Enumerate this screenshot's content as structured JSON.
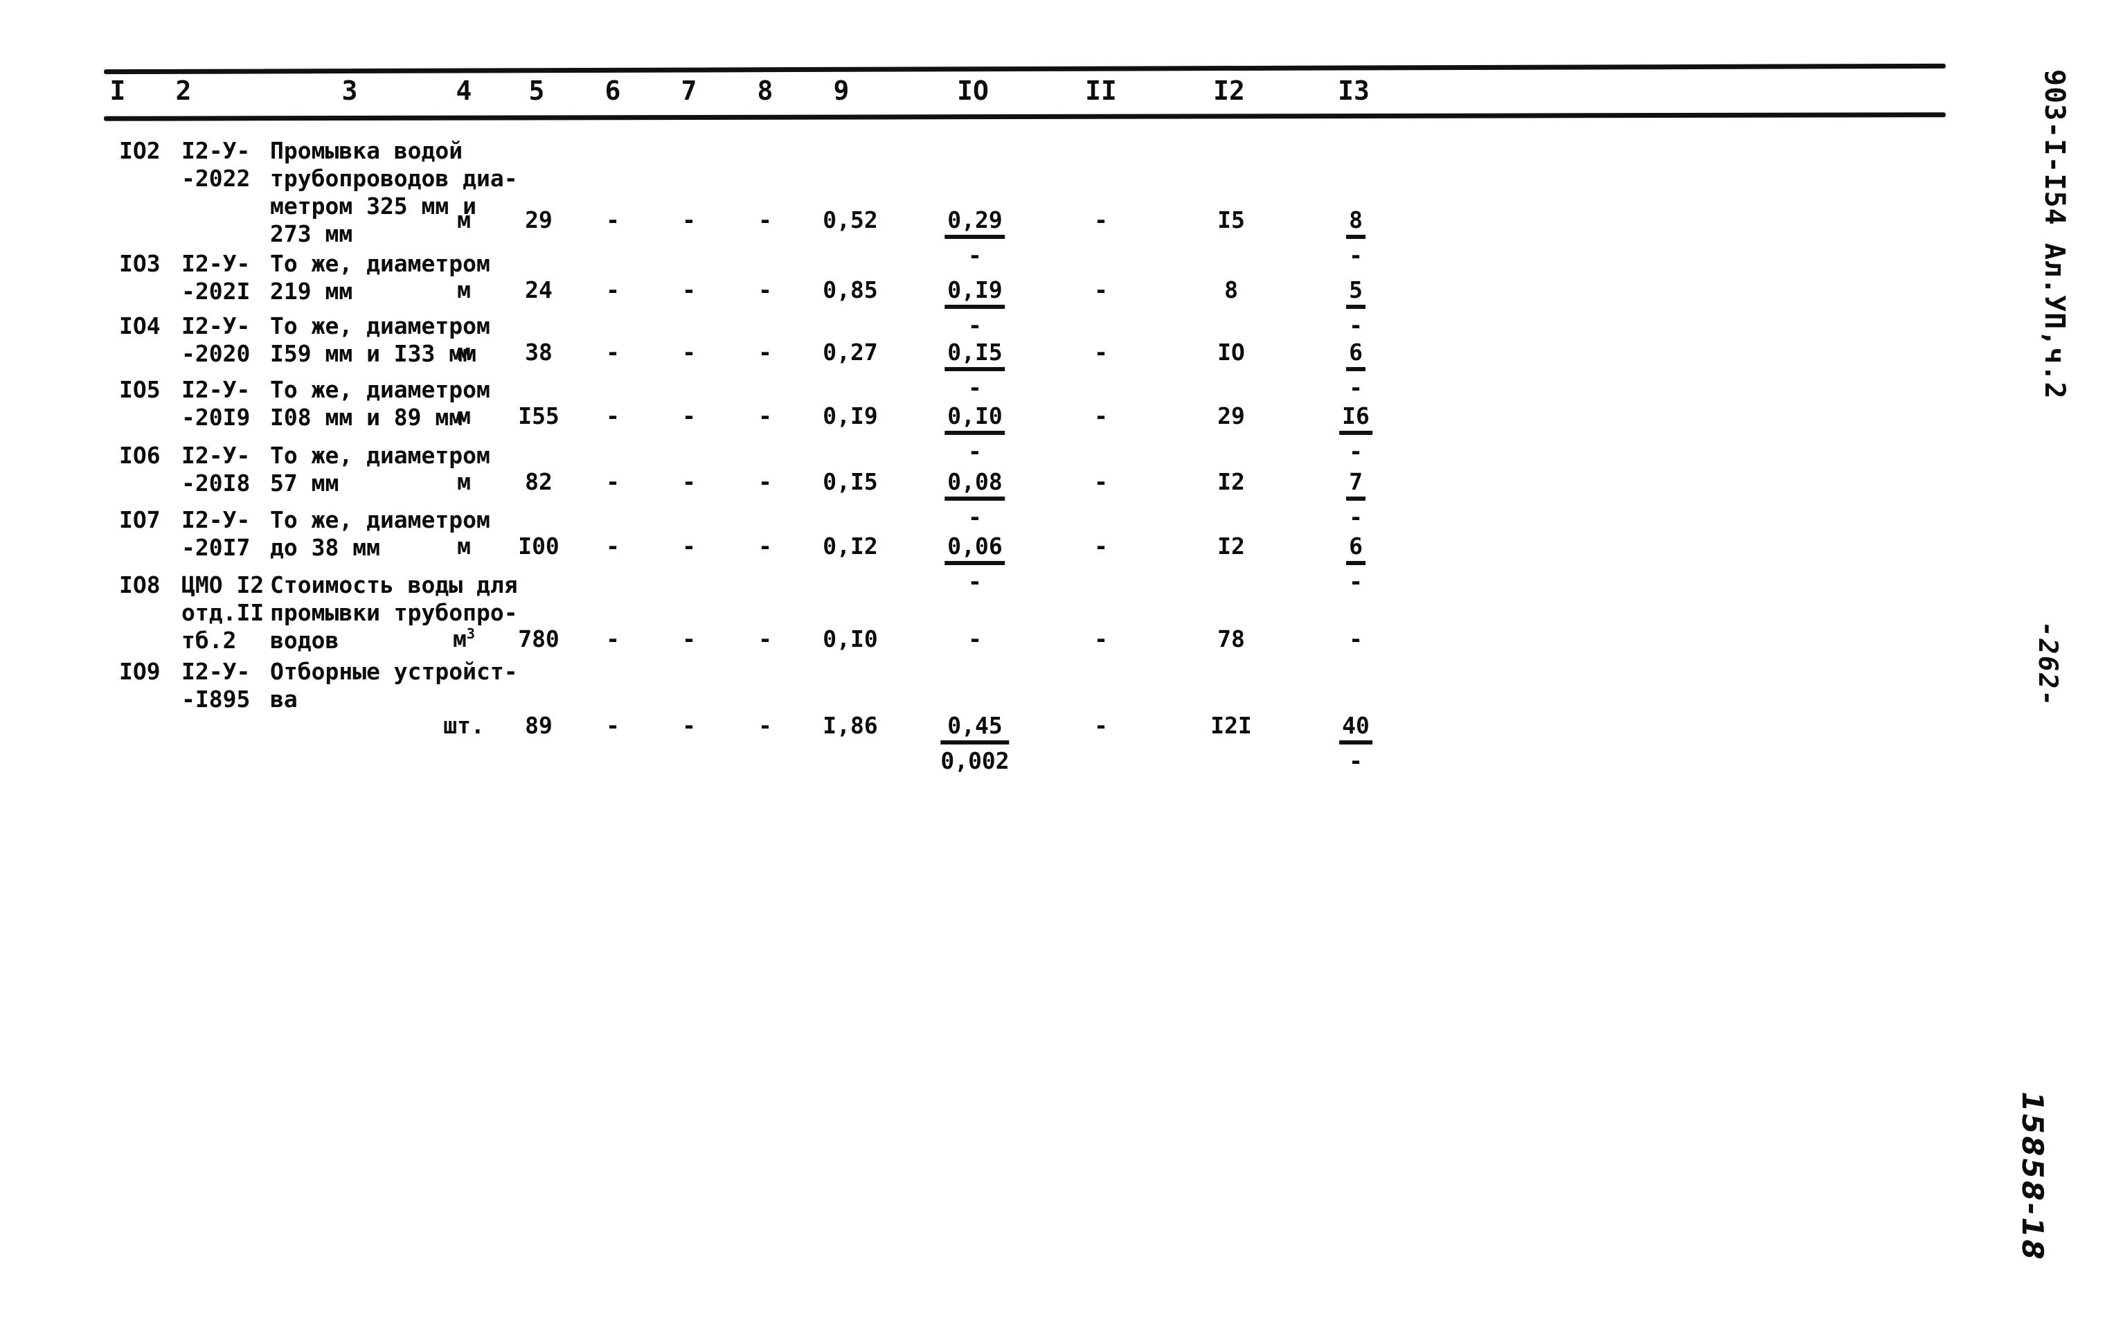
{
  "document": {
    "code_margin": "903-I-I54 Ал.УП,ч.2",
    "page_number": "-262-",
    "archive_stamp": "15858-18"
  },
  "table": {
    "column_headers": [
      "I",
      "2",
      "3",
      "4",
      "5",
      "6",
      "7",
      "8",
      "9",
      "IO",
      "II",
      "I2",
      "I3"
    ],
    "rows": [
      {
        "num": "IO2",
        "code": "I2-У-\n-2022",
        "name": "Промывка водой\nтрубопроводов диа-\nметром 325 мм и\n273 мм",
        "unit": "м",
        "qty": "29",
        "c6": "-",
        "c7": "-",
        "c8": "-",
        "c9": "0,52",
        "c10_num": "0,29",
        "c10_den": "-",
        "c11": "-",
        "c12": "I5",
        "c13_num": "8",
        "c13_den": "-"
      },
      {
        "num": "IO3",
        "code": "I2-У-\n-202I",
        "name": "То же, диаметром\n219 мм",
        "unit": "м",
        "qty": "24",
        "c6": "-",
        "c7": "-",
        "c8": "-",
        "c9": "0,85",
        "c10_num": "0,I9",
        "c10_den": "-",
        "c11": "-",
        "c12": "8",
        "c13_num": "5",
        "c13_den": "-"
      },
      {
        "num": "IO4",
        "code": "I2-У-\n-2020",
        "name": "То же, диаметром\nI59 мм и I33 мм",
        "unit": "м",
        "qty": "38",
        "c6": "-",
        "c7": "-",
        "c8": "-",
        "c9": "0,27",
        "c10_num": "0,I5",
        "c10_den": "-",
        "c11": "-",
        "c12": "IO",
        "c13_num": "6",
        "c13_den": "-"
      },
      {
        "num": "IO5",
        "code": "I2-У-\n-20I9",
        "name": "То же, диаметром\nI08 мм и 89 мм",
        "unit": "м",
        "qty": "I55",
        "c6": "-",
        "c7": "-",
        "c8": "-",
        "c9": "0,I9",
        "c10_num": "0,I0",
        "c10_den": "-",
        "c11": "-",
        "c12": "29",
        "c13_num": "I6",
        "c13_den": "-"
      },
      {
        "num": "IO6",
        "code": "I2-У-\n-20I8",
        "name": "То же, диаметром\n57 мм",
        "unit": "м",
        "qty": "82",
        "c6": "-",
        "c7": "-",
        "c8": "-",
        "c9": "0,I5",
        "c10_num": "0,08",
        "c10_den": "-",
        "c11": "-",
        "c12": "I2",
        "c13_num": "7",
        "c13_den": "-"
      },
      {
        "num": "IO7",
        "code": "I2-У-\n-20I7",
        "name": "То же, диаметром\nдо 38 мм",
        "unit": "м",
        "qty": "I00",
        "c6": "-",
        "c7": "-",
        "c8": "-",
        "c9": "0,I2",
        "c10_num": "0,06",
        "c10_den": "-",
        "c11": "-",
        "c12": "I2",
        "c13_num": "6",
        "c13_den": "-"
      },
      {
        "num": "IO8",
        "code": "ЦМО I2\nотд.II\nтб.2",
        "name": "Стоимость воды для\nпромывки трубопро-\nводов",
        "unit": "м3",
        "qty": "780",
        "c6": "-",
        "c7": "-",
        "c8": "-",
        "c9": "0,I0",
        "c10_num": "-",
        "c10_den": "",
        "c11": "-",
        "c12": "78",
        "c13_num": "-",
        "c13_den": ""
      },
      {
        "num": "IO9",
        "code": "I2-У-\n-I895",
        "name": "Отборные устройст-\nва",
        "unit": "шт.",
        "qty": "89",
        "c6": "-",
        "c7": "-",
        "c8": "-",
        "c9": "I,86",
        "c10_num": "0,45",
        "c10_den": "0,002",
        "c11": "-",
        "c12": "I2I",
        "c13_num": "40",
        "c13_den": "-"
      }
    ]
  }
}
